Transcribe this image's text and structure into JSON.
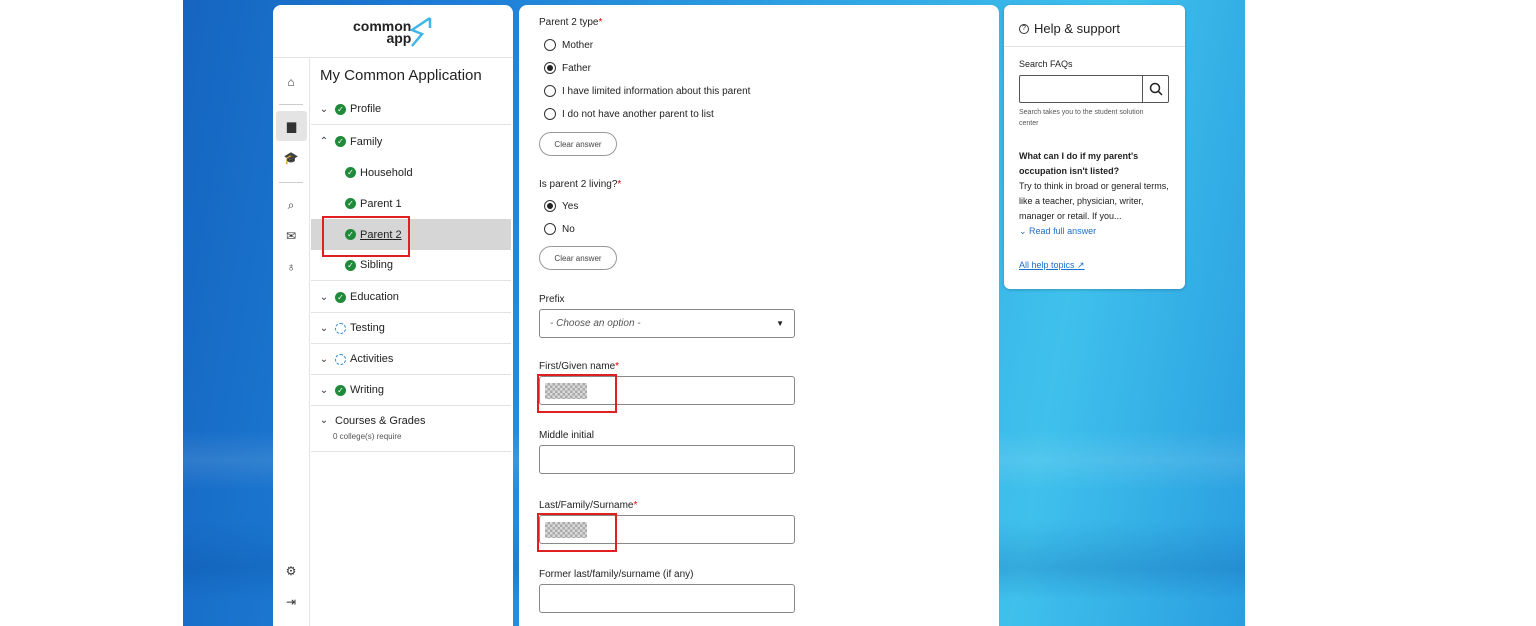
{
  "logo": {
    "line1": "common",
    "line2": "app"
  },
  "nav": {
    "title": "My Common Application",
    "sections": [
      {
        "label": "Profile",
        "status": "complete",
        "expanded": false
      },
      {
        "label": "Family",
        "status": "complete",
        "expanded": true
      },
      {
        "label": "Education",
        "status": "complete",
        "expanded": false
      },
      {
        "label": "Testing",
        "status": "in-progress",
        "expanded": false
      },
      {
        "label": "Activities",
        "status": "in-progress",
        "expanded": false
      },
      {
        "label": "Writing",
        "status": "complete",
        "expanded": false
      },
      {
        "label": "Courses & Grades",
        "status": "none",
        "expanded": false
      }
    ],
    "family_items": [
      "Household",
      "Parent 1",
      "Parent 2",
      "Sibling"
    ],
    "selected_item": "Parent 2",
    "courses_note": "0 college(s) require"
  },
  "form": {
    "parent_type_label": "Parent 2 type",
    "parent_type_options": [
      "Mother",
      "Father",
      "I have limited information about this parent",
      "I do not have another parent to list"
    ],
    "parent_type_selected": "Father",
    "clear_answer": "Clear answer",
    "living_label": "Is parent 2 living?",
    "living_options": [
      "Yes",
      "No"
    ],
    "living_selected": "Yes",
    "prefix_label": "Prefix",
    "prefix_placeholder": "- Choose an option -",
    "first_name_label": "First/Given name",
    "middle_initial_label": "Middle initial",
    "last_name_label": "Last/Family/Surname",
    "former_last_name_label": "Former last/family/surname (if any)"
  },
  "help": {
    "title": "Help & support",
    "search_label": "Search FAQs",
    "search_hint": "Search takes you to the student solution center",
    "question": "What can I do if my parent's occupation isn't listed?",
    "answer": "Try to think in broad or general terms, like a teacher, physician, writer, manager or retail. If you...",
    "read_full": "Read full answer",
    "all_topics": "All help topics"
  },
  "colors": {
    "complete": "#1f8a3a",
    "in_progress": "#3a8bd6",
    "link": "#1a6fc9",
    "highlight": "#e02020"
  }
}
